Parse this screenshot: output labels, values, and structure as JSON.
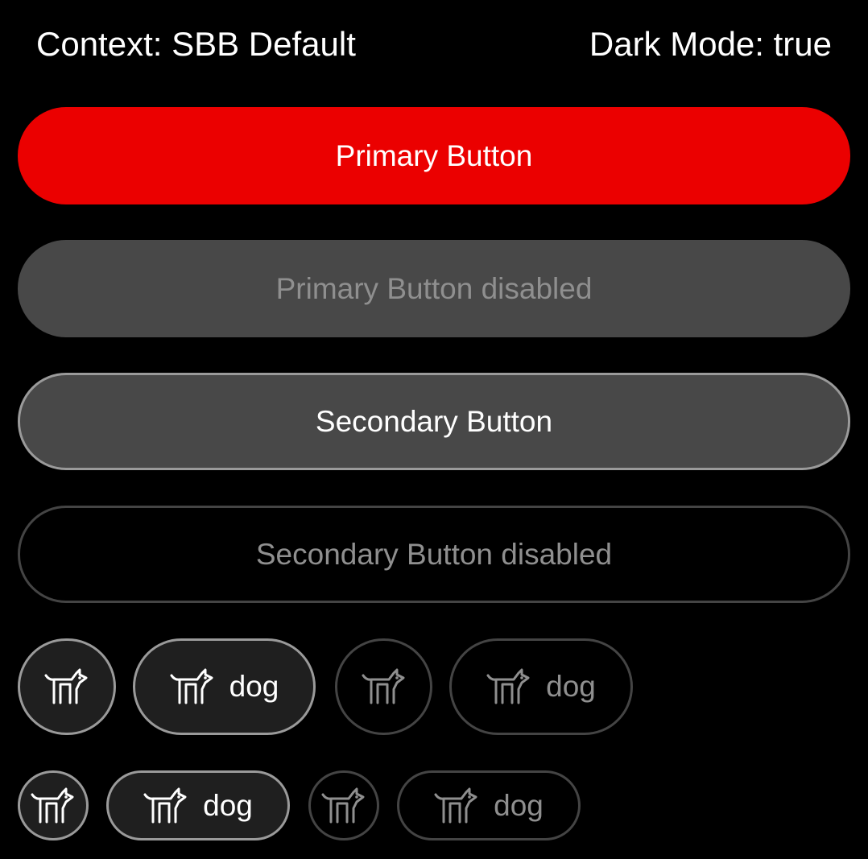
{
  "header": {
    "context": "Context: SBB Default",
    "dark_mode": "Dark Mode: true"
  },
  "buttons": {
    "primary": "Primary Button",
    "primary_disabled": "Primary Button disabled",
    "secondary": "Secondary Button",
    "secondary_disabled": "Secondary Button disabled"
  },
  "icon_buttons": {
    "label": "dog",
    "icon": "dog-icon"
  },
  "colors": {
    "background": "#000000",
    "primary": "#eb0000",
    "disabled_fill": "#484848",
    "enabled_border": "#9a9a9a",
    "disabled_border": "#444444",
    "disabled_text": "#8f8f8f"
  }
}
